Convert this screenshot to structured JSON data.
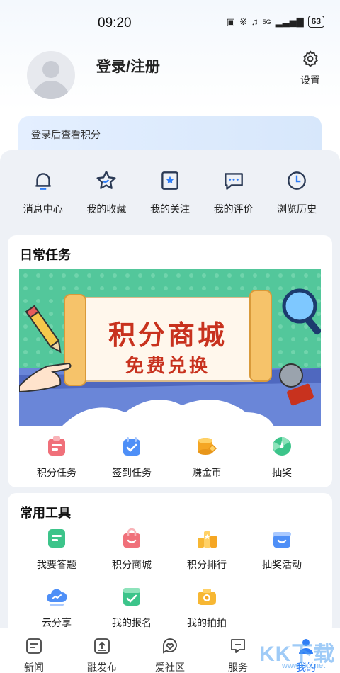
{
  "status_bar": {
    "time": "09:20",
    "net": "5G",
    "battery": "63"
  },
  "profile": {
    "login_label": "登录/注册",
    "settings_label": "设置"
  },
  "points_card": {
    "text": "登录后查看积分"
  },
  "quick_actions": [
    {
      "label": "消息中心",
      "icon": "bell-icon"
    },
    {
      "label": "我的收藏",
      "icon": "star-icon"
    },
    {
      "label": "我的关注",
      "icon": "bookmark-star-icon"
    },
    {
      "label": "我的评价",
      "icon": "chat-bubble-icon"
    },
    {
      "label": "浏览历史",
      "icon": "clock-icon"
    }
  ],
  "daily_tasks": {
    "title": "日常任务",
    "banner": {
      "line1": "积分商城",
      "line2": "免费兑换"
    },
    "items": [
      {
        "label": "积分任务",
        "icon": "task-clipboard-icon"
      },
      {
        "label": "签到任务",
        "icon": "calendar-check-icon"
      },
      {
        "label": "赚金币",
        "icon": "coin-stack-icon"
      },
      {
        "label": "抽奖",
        "icon": "prize-wheel-icon"
      }
    ]
  },
  "common_tools": {
    "title": "常用工具",
    "items": [
      {
        "label": "我要答题",
        "icon": "answer-doc-icon"
      },
      {
        "label": "积分商城",
        "icon": "shopping-bag-icon"
      },
      {
        "label": "积分排行",
        "icon": "ranking-podium-icon"
      },
      {
        "label": "抽奖活动",
        "icon": "gift-box-icon"
      },
      {
        "label": "云分享",
        "icon": "cloud-share-icon"
      },
      {
        "label": "我的报名",
        "icon": "signup-check-icon"
      },
      {
        "label": "我的拍拍",
        "icon": "camera-icon"
      }
    ]
  },
  "bottom_nav": [
    {
      "label": "新闻",
      "icon": "news-icon"
    },
    {
      "label": "融发布",
      "icon": "publish-icon"
    },
    {
      "label": "爱社区",
      "icon": "community-heart-icon"
    },
    {
      "label": "服务",
      "icon": "service-icon"
    },
    {
      "label": "我的",
      "icon": "user-icon",
      "active": true
    }
  ],
  "watermark": {
    "brand": "KK下载",
    "url": "www.kkx.net"
  },
  "colors": {
    "accent": "#2f7df6",
    "banner_green": "#53c79b",
    "banner_red": "#c8321e"
  }
}
